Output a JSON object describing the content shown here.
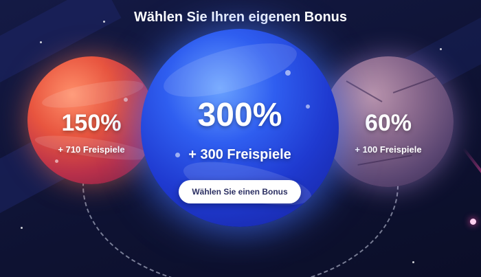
{
  "heading": "Wählen Sie Ihren eigenen Bonus",
  "bonuses": [
    {
      "percent": "150%",
      "free_spins": "+ 710 Freispiele"
    },
    {
      "percent": "300%",
      "free_spins": "+ 300 Freispiele"
    },
    {
      "percent": "60%",
      "free_spins": "+ 100 Freispiele"
    }
  ],
  "cta_label": "Wählen Sie einen Bonus",
  "colors": {
    "background": "#10153a",
    "planet_left": "#e8553f",
    "planet_center": "#2f5ef0",
    "planet_right": "#8b6a8e",
    "button_bg": "#ffffff",
    "button_text": "#2b2f62",
    "comet": "#ff4fa8"
  }
}
